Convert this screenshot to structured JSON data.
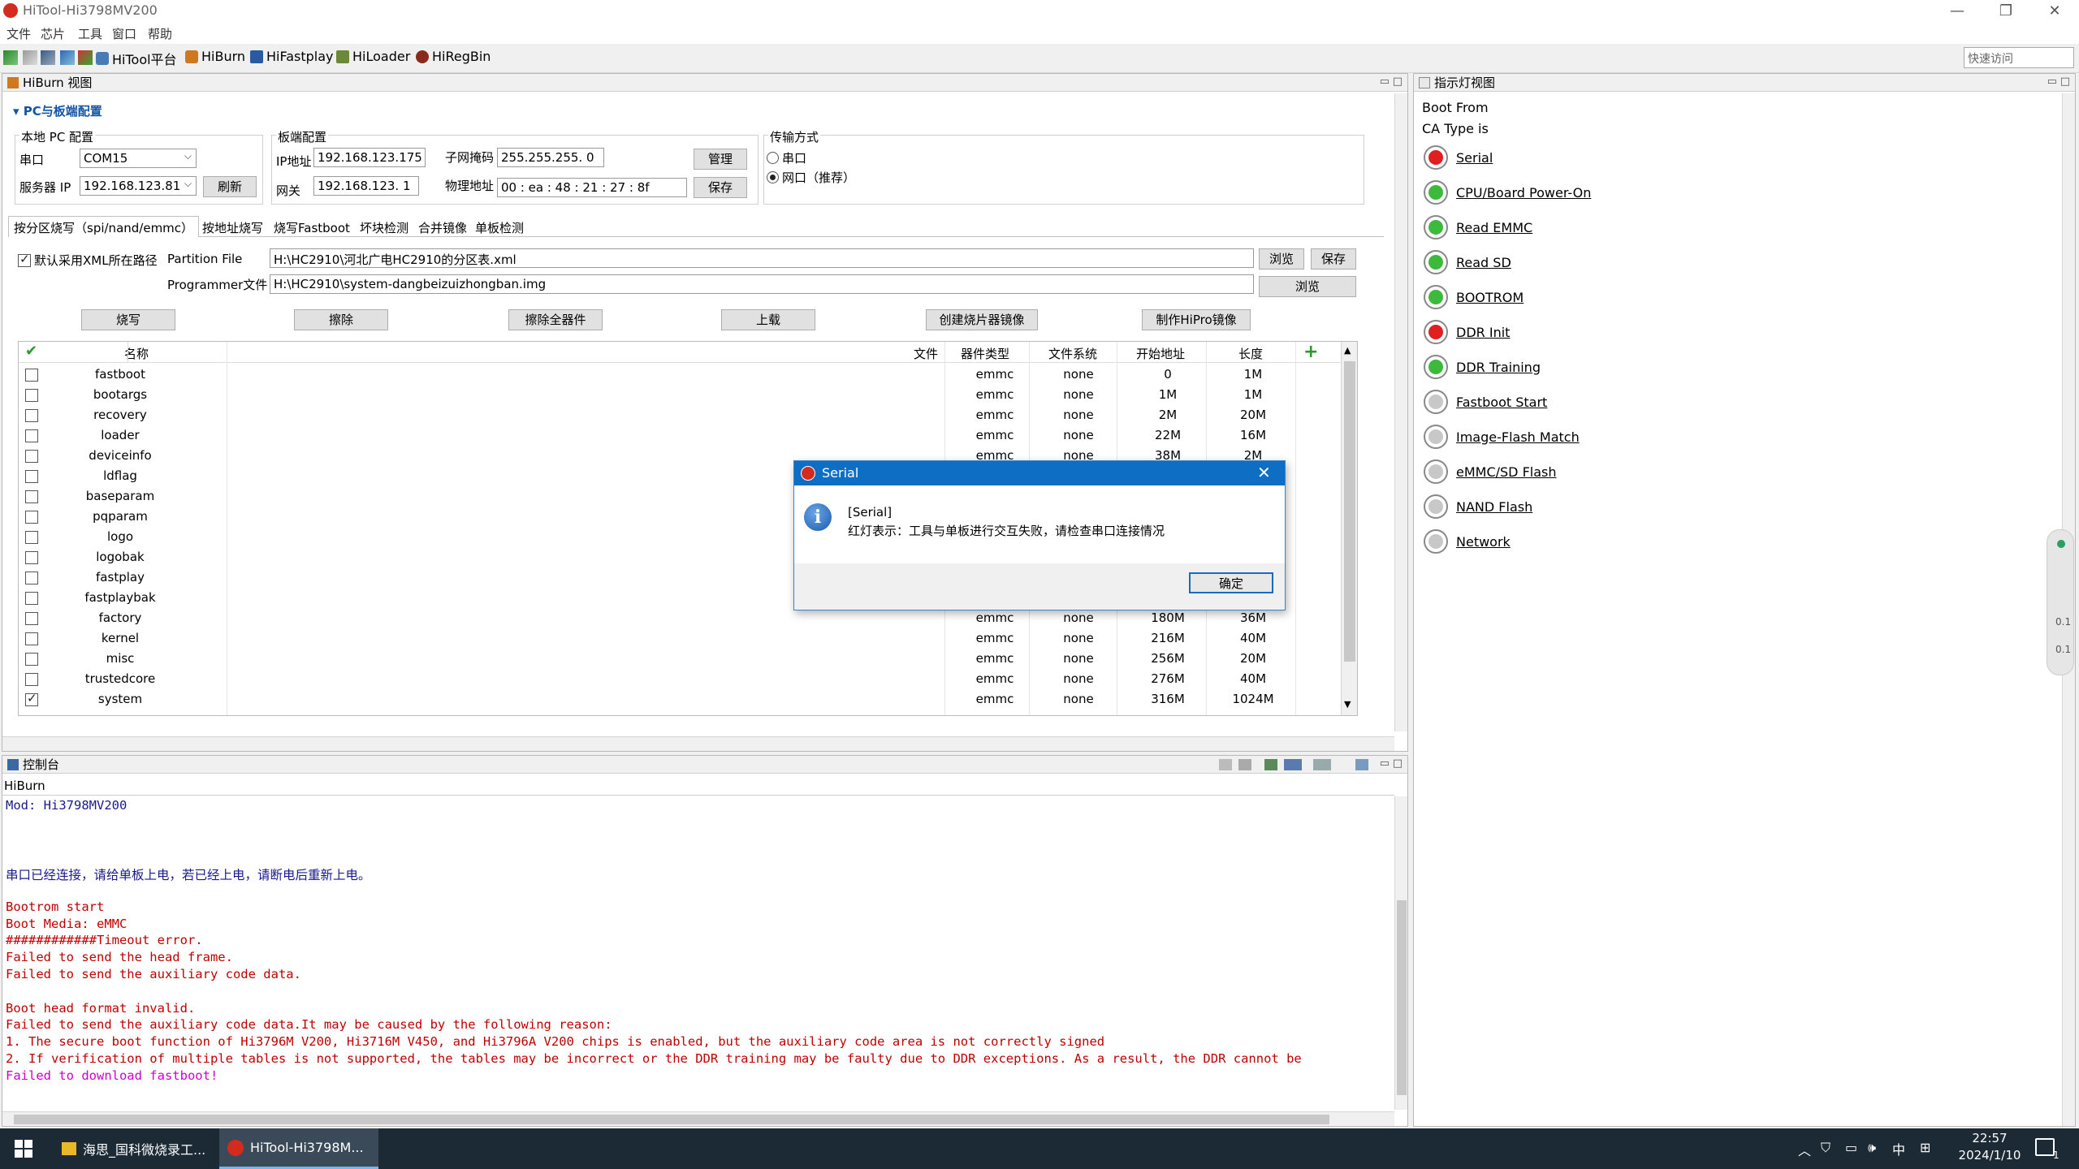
{
  "window": {
    "title": "HiTool-Hi3798MV200",
    "controls": [
      "—",
      "❐",
      "✕"
    ]
  },
  "menu": [
    "文件",
    "芯片",
    "工具",
    "窗口",
    "帮助"
  ],
  "toolbar": {
    "buttons": [
      "HiTool平台",
      "HiBurn",
      "HiFastplay",
      "HiLoader",
      "HiRegBin"
    ],
    "quick_access_placeholder": "快速访问"
  },
  "hiburn": {
    "panel_title": "HiBurn 视图",
    "section_title": "PC与板端配置",
    "local_pc": {
      "group_label": "本地 PC 配置",
      "serial_label": "串口",
      "serial_value": "COM15",
      "server_ip_label": "服务器 IP",
      "server_ip_value": "192.168.123.81",
      "refresh": "刷新"
    },
    "board": {
      "group_label": "板端配置",
      "ip_label": "IP地址",
      "ip_value": "192.168.123.175",
      "mask_label": "子网掩码",
      "mask_value": "255.255.255. 0",
      "gateway_label": "网关",
      "gateway_value": "192.168.123. 1",
      "mac_label": "物理地址",
      "mac_value": "00 : ea : 48 : 21 : 27 : 8f",
      "manage": "管理",
      "save": "保存"
    },
    "transfer": {
      "group_label": "传输方式",
      "serial": "串口",
      "network": "网口（推荐）"
    },
    "tabs": [
      "按分区烧写（spi/nand/emmc）",
      "按地址烧写",
      "烧写Fastboot",
      "坏块检测",
      "合并镜像",
      "单板检测"
    ],
    "use_xml_label": "默认采用XML所在路径",
    "partition_file_label": "Partition File",
    "partition_file_value": "H:\\HC2910\\河北广电HC2910的分区表.xml",
    "programmer_label": "Programmer文件",
    "programmer_value": "H:\\HC2910\\system-dangbeizuizhongban.img",
    "browse": "浏览",
    "save": "保存",
    "actions": [
      "烧写",
      "擦除",
      "擦除全器件",
      "上载",
      "创建烧片器镜像",
      "制作HiPro镜像"
    ],
    "table": {
      "headers": [
        "名称",
        "文件",
        "器件类型",
        "文件系统",
        "开始地址",
        "长度"
      ],
      "rows": [
        {
          "checked": false,
          "name": "fastboot",
          "type": "emmc",
          "fs": "none",
          "start": "0",
          "len": "1M"
        },
        {
          "checked": false,
          "name": "bootargs",
          "type": "emmc",
          "fs": "none",
          "start": "1M",
          "len": "1M"
        },
        {
          "checked": false,
          "name": "recovery",
          "type": "emmc",
          "fs": "none",
          "start": "2M",
          "len": "20M"
        },
        {
          "checked": false,
          "name": "loader",
          "type": "emmc",
          "fs": "none",
          "start": "22M",
          "len": "16M"
        },
        {
          "checked": false,
          "name": "deviceinfo",
          "type": "emmc",
          "fs": "none",
          "start": "38M",
          "len": "2M"
        },
        {
          "checked": false,
          "name": "ldflag",
          "type": "",
          "fs": "",
          "start": "",
          "len": ""
        },
        {
          "checked": false,
          "name": "baseparam",
          "type": "",
          "fs": "",
          "start": "",
          "len": ""
        },
        {
          "checked": false,
          "name": "pqparam",
          "type": "",
          "fs": "",
          "start": "",
          "len": ""
        },
        {
          "checked": false,
          "name": "logo",
          "type": "",
          "fs": "",
          "start": "",
          "len": ""
        },
        {
          "checked": false,
          "name": "logobak",
          "type": "",
          "fs": "",
          "start": "",
          "len": ""
        },
        {
          "checked": false,
          "name": "fastplay",
          "type": "",
          "fs": "",
          "start": "",
          "len": ""
        },
        {
          "checked": false,
          "name": "fastplaybak",
          "type": "",
          "fs": "",
          "start": "",
          "len": ""
        },
        {
          "checked": false,
          "name": "factory",
          "type": "emmc",
          "fs": "none",
          "start": "180M",
          "len": "36M"
        },
        {
          "checked": false,
          "name": "kernel",
          "type": "emmc",
          "fs": "none",
          "start": "216M",
          "len": "40M"
        },
        {
          "checked": false,
          "name": "misc",
          "type": "emmc",
          "fs": "none",
          "start": "256M",
          "len": "20M"
        },
        {
          "checked": false,
          "name": "trustedcore",
          "type": "emmc",
          "fs": "none",
          "start": "276M",
          "len": "40M"
        },
        {
          "checked": true,
          "name": "system",
          "type": "emmc",
          "fs": "none",
          "start": "316M",
          "len": "1024M"
        }
      ]
    }
  },
  "indicator": {
    "panel_title": "指示灯视图",
    "boot_from": "Boot From",
    "ca_type": "CA Type is",
    "items": [
      {
        "label": "Serial",
        "state": "red"
      },
      {
        "label": "CPU/Board Power-On",
        "state": "green"
      },
      {
        "label": "Read EMMC",
        "state": "green"
      },
      {
        "label": "Read SD",
        "state": "green"
      },
      {
        "label": "BOOTROM",
        "state": "green"
      },
      {
        "label": "DDR Init",
        "state": "red"
      },
      {
        "label": "DDR Training",
        "state": "green"
      },
      {
        "label": "Fastboot Start",
        "state": "gray"
      },
      {
        "label": "Image-Flash Match",
        "state": "gray"
      },
      {
        "label": "eMMC/SD Flash",
        "state": "gray"
      },
      {
        "label": "NAND Flash",
        "state": "gray"
      },
      {
        "label": "Network",
        "state": "gray"
      }
    ]
  },
  "console": {
    "panel_title": "控制台",
    "tab": "HiBurn",
    "lines": [
      {
        "text": "Mod: Hi3798MV200",
        "color": "#1a1a8c"
      },
      {
        "text": "",
        "color": "#000"
      },
      {
        "text": "",
        "color": "#000"
      },
      {
        "text": "",
        "color": "#000"
      },
      {
        "text": "串口已经连接，请给单板上电，若已经上电，请断电后重新上电。",
        "color": "#1a1a8c"
      },
      {
        "text": "",
        "color": "#000"
      },
      {
        "text": "Bootrom start",
        "color": "#c00000"
      },
      {
        "text": "Boot Media: eMMC",
        "color": "#c00000"
      },
      {
        "text": "############Timeout error.",
        "color": "#c00000"
      },
      {
        "text": "Failed to send the head frame.",
        "color": "#c00000"
      },
      {
        "text": "Failed to send the auxiliary code data.",
        "color": "#c00000"
      },
      {
        "text": "",
        "color": "#000"
      },
      {
        "text": "Boot head format invalid.",
        "color": "#c00000"
      },
      {
        "text": "Failed to send the auxiliary code data.It may be caused by the following reason:",
        "color": "#c00000"
      },
      {
        "text": "1. The secure boot function of Hi3796M V200, Hi3716M V450, and Hi3796A V200 chips is enabled, but the auxiliary code area is not correctly signed",
        "color": "#c00000"
      },
      {
        "text": "2. If verification of multiple tables is not supported, the tables may be incorrect or the DDR training may be faulty due to DDR exceptions. As a result, the DDR cannot be",
        "color": "#c00000"
      },
      {
        "text": "Failed to download fastboot!",
        "color": "#cc00cc"
      }
    ]
  },
  "dialog": {
    "title": "Serial",
    "heading": "[Serial]",
    "message": "红灯表示：工具与单板进行交互失败，请检查串口连接情况",
    "ok": "确定"
  },
  "taskbar": {
    "items": [
      "海思_国科微烧录工...",
      "HiTool-Hi3798M..."
    ],
    "ime": "中",
    "time": "22:57",
    "date": "2024/1/10",
    "notif_count": "1"
  },
  "net_widget": [
    "0.1",
    "0.1"
  ],
  "colors": {
    "title_blue": "#0e6ec3",
    "taskbar": "#1c2a36",
    "section_blue": "#1556a4"
  }
}
